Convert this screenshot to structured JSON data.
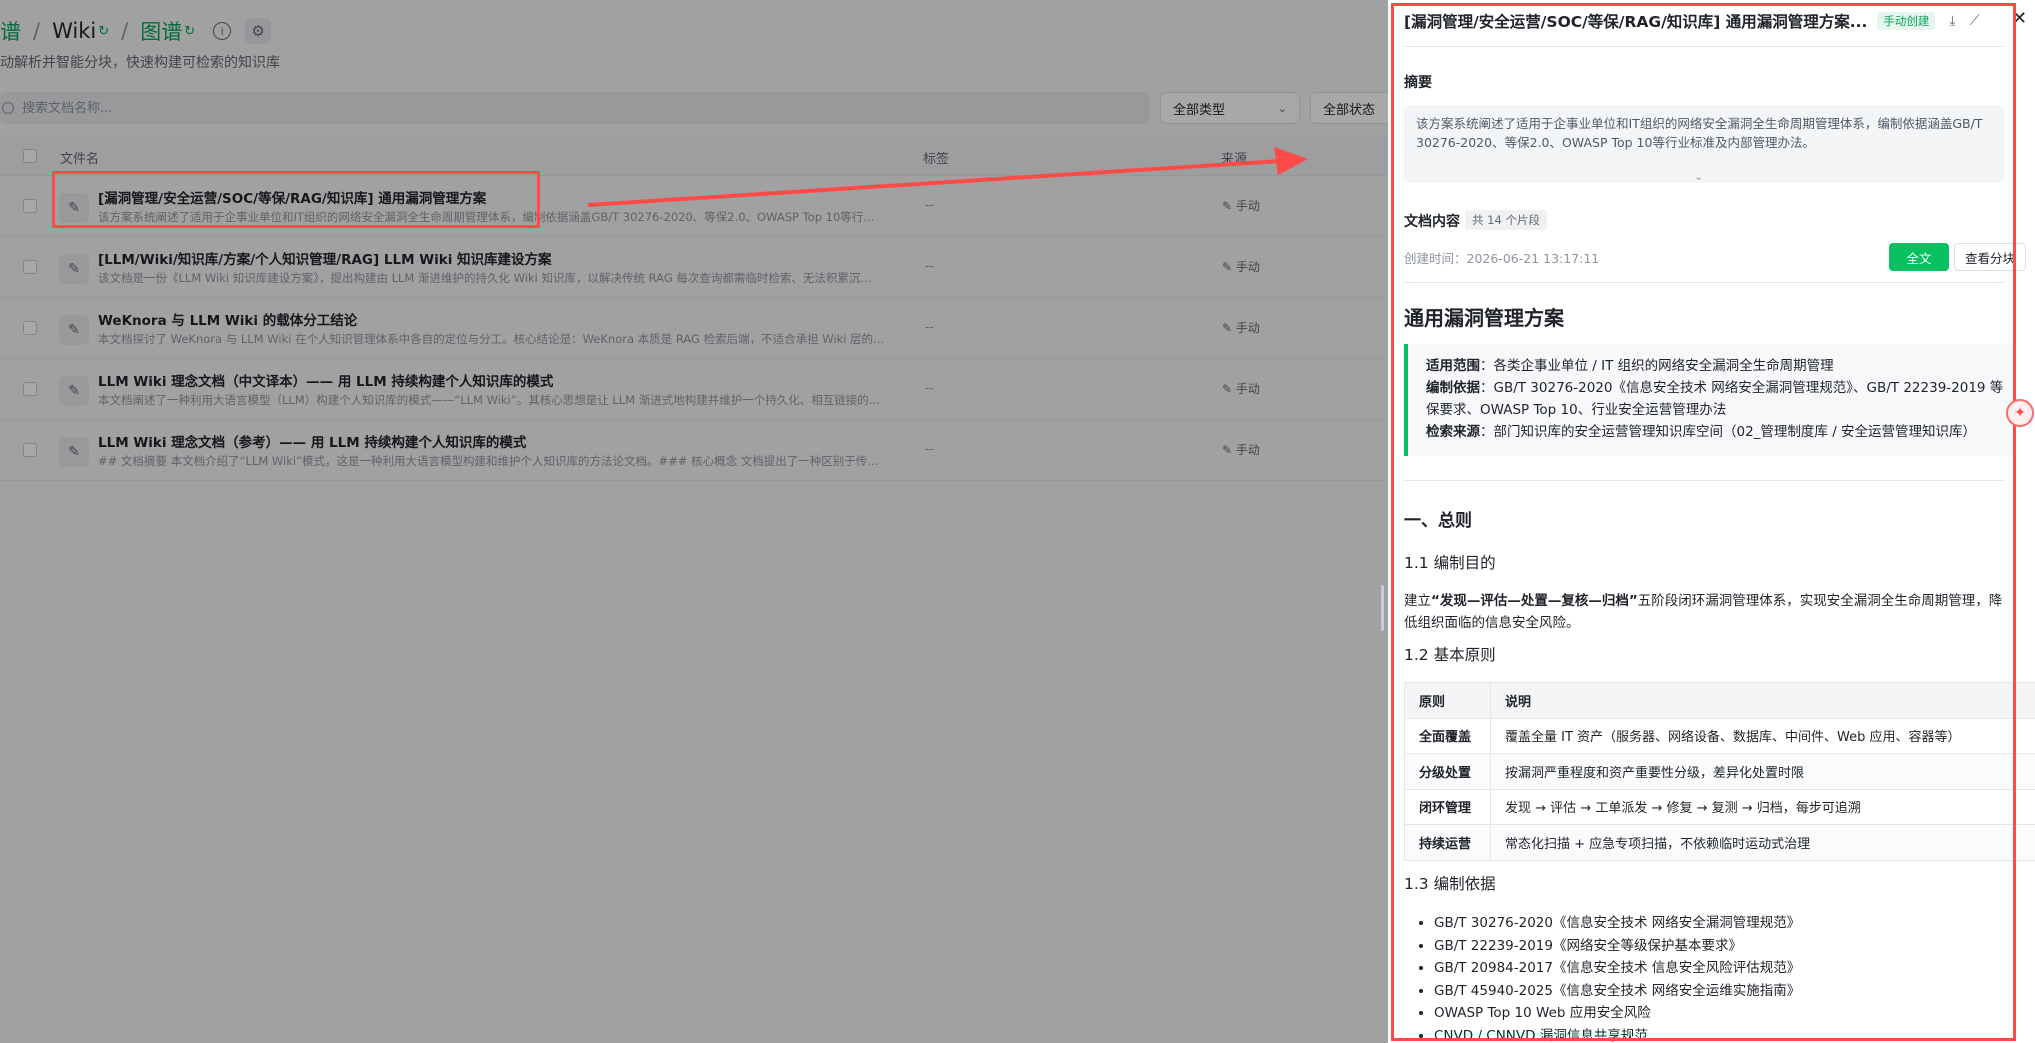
{
  "breadcrumb": {
    "item1": "谱",
    "item2": "Wiki",
    "item3": "图谱"
  },
  "subtitle": "动解析并智能分块，快速构建可检索的知识库",
  "search": {
    "placeholder": "搜索文档名称..."
  },
  "filters": {
    "type": "全部类型",
    "status": "全部状态"
  },
  "table": {
    "headers": {
      "name": "文件名",
      "tag": "标签",
      "source": "来源"
    },
    "rows": [
      {
        "title": "[漏洞管理/安全运营/SOC/等保/RAG/知识库] 通用漏洞管理方案",
        "summary": "该方案系统阐述了适用于企事业单位和IT组织的网络安全漏洞全生命周期管理体系，编制依据涵盖GB/T 30276-2020、等保2.0、OWASP Top 10等行...",
        "tag": "--",
        "source": "手动"
      },
      {
        "title": "[LLM/Wiki/知识库/方案/个人知识管理/RAG] LLM Wiki 知识库建设方案",
        "summary": "该文档是一份《LLM Wiki 知识库建设方案》，提出构建由 LLM 渐进维护的持久化 Wiki 知识库，以解决传统 RAG 每次查询都需临时检索、无法积累沉...",
        "tag": "--",
        "source": "手动"
      },
      {
        "title": "WeKnora 与 LLM Wiki 的载体分工结论",
        "summary": "本文档探讨了 WeKnora 与 LLM Wiki 在个人知识管理体系中各自的定位与分工。核心结论是：WeKnora 本质是 RAG 检索后端，不适合承担 Wiki 层的...",
        "tag": "--",
        "source": "手动"
      },
      {
        "title": "LLM Wiki 理念文档（中文译本）—— 用 LLM 持续构建个人知识库的模式",
        "summary": "本文档阐述了一种利用大语言模型（LLM）构建个人知识库的模式——“LLM Wiki”。其核心思想是让 LLM 渐进式地构建并维护一个持久化、相互链接的...",
        "tag": "--",
        "source": "手动"
      },
      {
        "title": "LLM Wiki 理念文档（参考）—— 用 LLM 持续构建个人知识库的模式",
        "summary": "## 文档摘要 本文档介绍了“LLM Wiki”模式，这是一种利用大语言模型构建和维护个人知识库的方法论文档。### 核心概念 文档提出了一种区别于传...",
        "tag": "--",
        "source": "手动"
      }
    ]
  },
  "drawer": {
    "title": "[漏洞管理/安全运营/SOC/等保/RAG/知识库] 通用漏洞管理方案...",
    "badge": "手动创建",
    "summary_label": "摘要",
    "summary_text": "该方案系统阐述了适用于企事业单位和IT组织的网络安全漏洞全生命周期管理体系，编制依据涵盖GB/T 30276-2020、等保2.0、OWASP Top 10等行业标准及内部管理办法。",
    "content_label": "文档内容",
    "chunk_count": "共 14 个片段",
    "created": "创建时间：2026-06-21 13:17:11",
    "btn_full": "全文",
    "btn_chunks": "查看分块",
    "doc": {
      "h1": "通用漏洞管理方案",
      "quote": {
        "scope_k": "适用范围",
        "scope_v": "：各类企事业单位 / IT 组织的网络安全漏洞全生命周期管理",
        "basis_k": "编制依据",
        "basis_v": "：GB/T 30276-2020《信息安全技术 网络安全漏洞管理规范》、GB/T 22239-2019 等保要求、OWASP Top 10、行业安全运营管理办法",
        "src_k": "检索来源",
        "src_v": "：部门知识库的安全运营管理知识库空间（02_管理制度库 / 安全运营管理知识库）"
      },
      "sec1": "一、总则",
      "sec1_1": "1.1 编制目的",
      "para_pre": "建立",
      "para_bold": "“发现—评估—处置—复核—归档”",
      "para_post": "五阶段闭环漏洞管理体系，实现安全漏洞全生命周期管理，降低组织面临的信息安全风险。",
      "sec1_2": "1.2 基本原则",
      "principles_head": [
        "原则",
        "说明"
      ],
      "principles": [
        {
          "k": "全面覆盖",
          "v": "覆盖全量 IT 资产（服务器、网络设备、数据库、中间件、Web 应用、容器等）"
        },
        {
          "k": "分级处置",
          "v": "按漏洞严重程度和资产重要性分级，差异化处置时限"
        },
        {
          "k": "闭环管理",
          "v": "发现 → 评估 → 工单派发 → 修复 → 复测 → 归档，每步可追溯"
        },
        {
          "k": "持续运营",
          "v": "常态化扫描 + 应急专项扫描，不依赖临时运动式治理"
        }
      ],
      "sec1_3": "1.3 编制依据",
      "refs": [
        "GB/T 30276-2020《信息安全技术 网络安全漏洞管理规范》",
        "GB/T 22239-2019《网络安全等级保护基本要求》",
        "GB/T 20984-2017《信息安全技术 信息安全风险评估规范》",
        "GB/T 45940-2025《信息安全技术 网络安全运维实施指南》",
        "OWASP Top 10 Web 应用安全风险",
        "CNVD / CNNVD 漏洞信息共享规范"
      ]
    }
  },
  "colors": {
    "accent": "#07c160",
    "annotation": "#ff4a4a"
  },
  "icons": [
    "edit-icon",
    "info-icon",
    "gear-icon",
    "search-icon",
    "chevron-down-icon",
    "download-icon",
    "chart-icon",
    "close-icon"
  ]
}
